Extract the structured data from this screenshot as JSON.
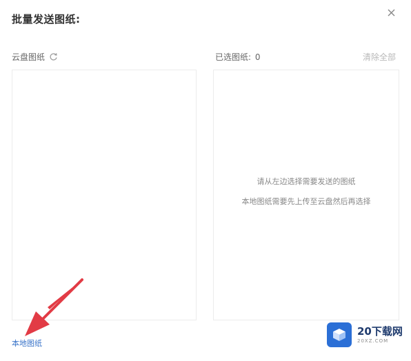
{
  "dialog": {
    "title": "批量发送图纸:",
    "close_symbol": "×"
  },
  "left_panel": {
    "header_label": "云盘图纸",
    "refresh_icon": "refresh-icon"
  },
  "right_panel": {
    "header_label": "已选图纸:",
    "selected_count": "0",
    "clear_all_label": "清除全部",
    "empty_hint_line1": "请从左边选择需要发送的图纸",
    "empty_hint_line2": "本地图纸需要先上传至云盘然后再选择"
  },
  "footer": {
    "local_drawings_link": "本地图纸"
  },
  "watermark": {
    "main_text": "20下载网",
    "sub_text": "20XZ.COM"
  },
  "colors": {
    "arrow": "#e23b45",
    "link": "#3a74c9",
    "watermark_blue": "#2b6fd6"
  }
}
